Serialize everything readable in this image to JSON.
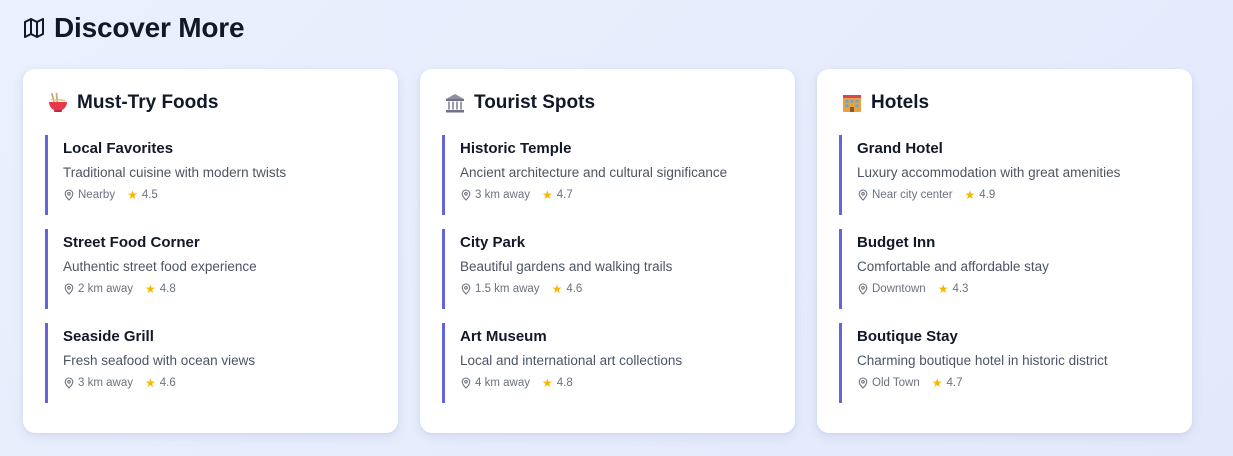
{
  "header": {
    "title": "Discover More",
    "icon": "map-icon"
  },
  "colors": {
    "accent": "#6366d9",
    "star": "#f5b800"
  },
  "cards": [
    {
      "title": "Must-Try Foods",
      "icon": "noodle-bowl-icon",
      "items": [
        {
          "name": "Local Favorites",
          "desc": "Traditional cuisine with modern twists",
          "distance": "Nearby",
          "rating": "4.5"
        },
        {
          "name": "Street Food Corner",
          "desc": "Authentic street food experience",
          "distance": "2 km away",
          "rating": "4.8"
        },
        {
          "name": "Seaside Grill",
          "desc": "Fresh seafood with ocean views",
          "distance": "3 km away",
          "rating": "4.6"
        }
      ]
    },
    {
      "title": "Tourist Spots",
      "icon": "classical-building-icon",
      "items": [
        {
          "name": "Historic Temple",
          "desc": "Ancient architecture and cultural significance",
          "distance": "3 km away",
          "rating": "4.7"
        },
        {
          "name": "City Park",
          "desc": "Beautiful gardens and walking trails",
          "distance": "1.5 km away",
          "rating": "4.6"
        },
        {
          "name": "Art Museum",
          "desc": "Local and international art collections",
          "distance": "4 km away",
          "rating": "4.8"
        }
      ]
    },
    {
      "title": "Hotels",
      "icon": "hotel-icon",
      "items": [
        {
          "name": "Grand Hotel",
          "desc": "Luxury accommodation with great amenities",
          "distance": "Near city center",
          "rating": "4.9"
        },
        {
          "name": "Budget Inn",
          "desc": "Comfortable and affordable stay",
          "distance": "Downtown",
          "rating": "4.3"
        },
        {
          "name": "Boutique Stay",
          "desc": "Charming boutique hotel in historic district",
          "distance": "Old Town",
          "rating": "4.7"
        }
      ]
    }
  ]
}
